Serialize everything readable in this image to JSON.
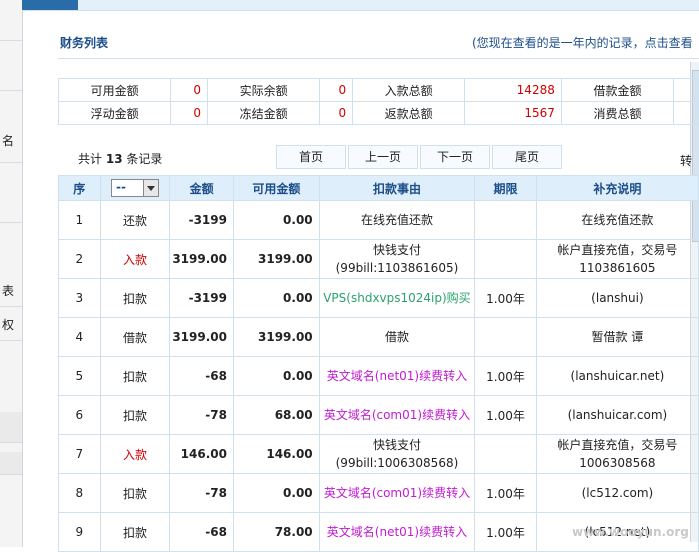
{
  "title": "财务列表",
  "note": "(您现在查看的是一年内的记录，点击查看",
  "left_nav": [
    "名",
    "表",
    "权"
  ],
  "summary": [
    [
      {
        "label": "可用金额",
        "value": "0"
      },
      {
        "label": "实际余额",
        "value": "0"
      },
      {
        "label": "入款总额",
        "value": "14288"
      },
      {
        "label": "借款金额",
        "value": ""
      }
    ],
    [
      {
        "label": "浮动金额",
        "value": "0"
      },
      {
        "label": "冻结金额",
        "value": "0"
      },
      {
        "label": "返款总额",
        "value": "1567"
      },
      {
        "label": "消费总额",
        "value": ""
      }
    ]
  ],
  "total": {
    "prefix": "共计",
    "count": "13",
    "suffix": "条记录"
  },
  "pager": [
    "首页",
    "上一页",
    "下一页",
    "尾页"
  ],
  "right_edge_text": "转",
  "table": {
    "headers": [
      "序",
      "--",
      "金额",
      "可用金额",
      "扣款事由",
      "期限",
      "补充说明"
    ],
    "select_value": "--",
    "rows": [
      {
        "no": "1",
        "type": "还款",
        "type_color": "black",
        "amount": "-3199",
        "available": "0.00",
        "reason": "在线充值还款",
        "reason_color": "black",
        "reason_line2": "",
        "term": "",
        "note": "在线充值还款",
        "note_line2": ""
      },
      {
        "no": "2",
        "type": "入款",
        "type_color": "red",
        "amount": "3199.00",
        "available": "3199.00",
        "reason": "快钱支付",
        "reason_color": "black",
        "reason_line2": "(99bill:1103861605)",
        "term": "",
        "note": "帐户直接充值，交易号",
        "note_line2": "1103861605"
      },
      {
        "no": "3",
        "type": "扣款",
        "type_color": "black",
        "amount": "-3199",
        "available": "0.00",
        "reason": "VPS(shdxvps1024ip)购买",
        "reason_color": "green",
        "reason_line2": "",
        "term": "1.00年",
        "note": "(lanshui)",
        "note_line2": ""
      },
      {
        "no": "4",
        "type": "借款",
        "type_color": "black",
        "amount": "3199.00",
        "available": "3199.00",
        "reason": "借款",
        "reason_color": "black",
        "reason_line2": "",
        "term": "",
        "note": "暂借款 谭",
        "note_line2": ""
      },
      {
        "no": "5",
        "type": "扣款",
        "type_color": "black",
        "amount": "-68",
        "available": "0.00",
        "reason": "英文域名(net01)续费转入",
        "reason_color": "magenta",
        "reason_line2": "",
        "term": "1.00年",
        "note": "(lanshuicar.net)",
        "note_line2": ""
      },
      {
        "no": "6",
        "type": "扣款",
        "type_color": "black",
        "amount": "-78",
        "available": "68.00",
        "reason": "英文域名(com01)续费转入",
        "reason_color": "magenta",
        "reason_line2": "",
        "term": "1.00年",
        "note": "(lanshuicar.com)",
        "note_line2": ""
      },
      {
        "no": "7",
        "type": "入款",
        "type_color": "red",
        "amount": "146.00",
        "available": "146.00",
        "reason": "快钱支付",
        "reason_color": "black",
        "reason_line2": "(99bill:1006308568)",
        "term": "",
        "note": "帐户直接充值，交易号",
        "note_line2": "1006308568"
      },
      {
        "no": "8",
        "type": "扣款",
        "type_color": "black",
        "amount": "-78",
        "available": "0.00",
        "reason": "英文域名(com01)续费转入",
        "reason_color": "magenta",
        "reason_line2": "",
        "term": "1.00年",
        "note": "(lc512.com)",
        "note_line2": ""
      },
      {
        "no": "9",
        "type": "扣款",
        "type_color": "black",
        "amount": "-68",
        "available": "78.00",
        "reason": "英文域名(net01)续费转入",
        "reason_color": "magenta",
        "reason_line2": "",
        "term": "1.00年",
        "note": "(lc512.net)",
        "note_line2": ""
      }
    ]
  },
  "watermark": "www.wooyun.org"
}
